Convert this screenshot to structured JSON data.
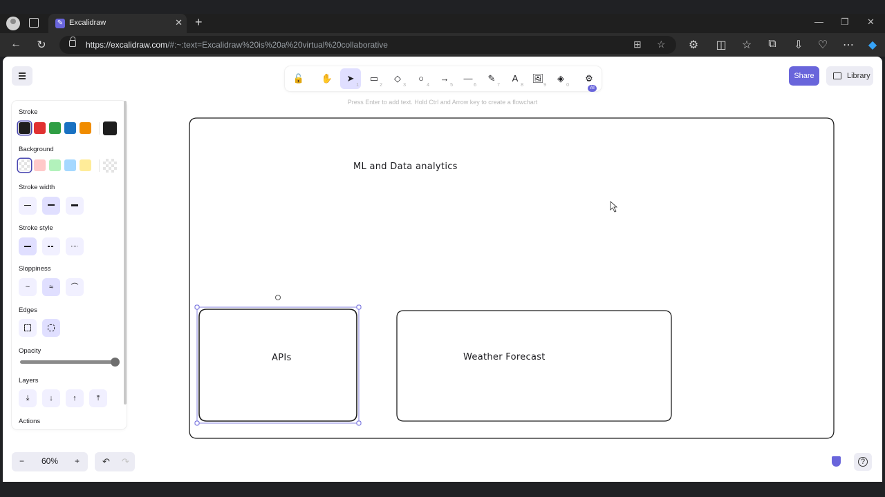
{
  "browser": {
    "tab_title": "Excalidraw",
    "tab_close": "✕",
    "new_tab": "+",
    "url_host": "https://excalidraw.com",
    "url_rest": "/#:~:text=Excalidraw%20is%20a%20virtual%20collaborative",
    "win_minimize": "—",
    "win_restore": "❐",
    "win_close": "✕"
  },
  "toolbar": {
    "tools": [
      {
        "name": "lock-tool",
        "glyph": "🔓",
        "key": ""
      },
      {
        "name": "hand-tool",
        "glyph": "✋",
        "key": ""
      },
      {
        "name": "selection-tool",
        "glyph": "➤",
        "key": "1",
        "active": true
      },
      {
        "name": "rectangle-tool",
        "glyph": "▭",
        "key": "2"
      },
      {
        "name": "diamond-tool",
        "glyph": "◇",
        "key": "3"
      },
      {
        "name": "ellipse-tool",
        "glyph": "○",
        "key": "4"
      },
      {
        "name": "arrow-tool",
        "glyph": "→",
        "key": "5"
      },
      {
        "name": "line-tool",
        "glyph": "—",
        "key": "6"
      },
      {
        "name": "draw-tool",
        "glyph": "✎",
        "key": "7"
      },
      {
        "name": "text-tool",
        "glyph": "A",
        "key": "8"
      },
      {
        "name": "image-tool",
        "glyph": "🖼",
        "key": "9"
      },
      {
        "name": "eraser-tool",
        "glyph": "◈",
        "key": "0"
      },
      {
        "name": "ai-tools",
        "glyph": "⚙",
        "key": ""
      }
    ],
    "ai_badge": "AI",
    "hint": "Press Enter to add text. Hold Ctrl and Arrow key to create a flowchart"
  },
  "header": {
    "share_label": "Share",
    "library_label": "Library"
  },
  "panel": {
    "stroke_title": "Stroke",
    "stroke_colors": [
      "#1e1e1e",
      "#e03131",
      "#2f9e44",
      "#1971c2",
      "#f08c00"
    ],
    "stroke_current": "#1e1e1e",
    "background_title": "Background",
    "background_colors": [
      "transparent",
      "#ffc9c9",
      "#b2f2bb",
      "#a5d8ff",
      "#ffec99"
    ],
    "stroke_width_title": "Stroke width",
    "stroke_style_title": "Stroke style",
    "sloppiness_title": "Sloppiness",
    "edges_title": "Edges",
    "opacity_title": "Opacity",
    "opacity_value": 100,
    "layers_title": "Layers",
    "layers_glyphs": [
      "⤓",
      "↓",
      "↑",
      "⤒"
    ],
    "actions_title": "Actions",
    "sloppy_glyphs": [
      "~",
      "≈",
      "⌒"
    ],
    "accent": "#6965db"
  },
  "canvas": {
    "title_text": "ML and Data analytics",
    "box1_label": "APIs",
    "box2_label": "Weather Forecast"
  },
  "footer": {
    "zoom_out": "−",
    "zoom_level": "60%",
    "zoom_in": "+",
    "undo": "↶",
    "redo": "↷",
    "help": "?"
  }
}
